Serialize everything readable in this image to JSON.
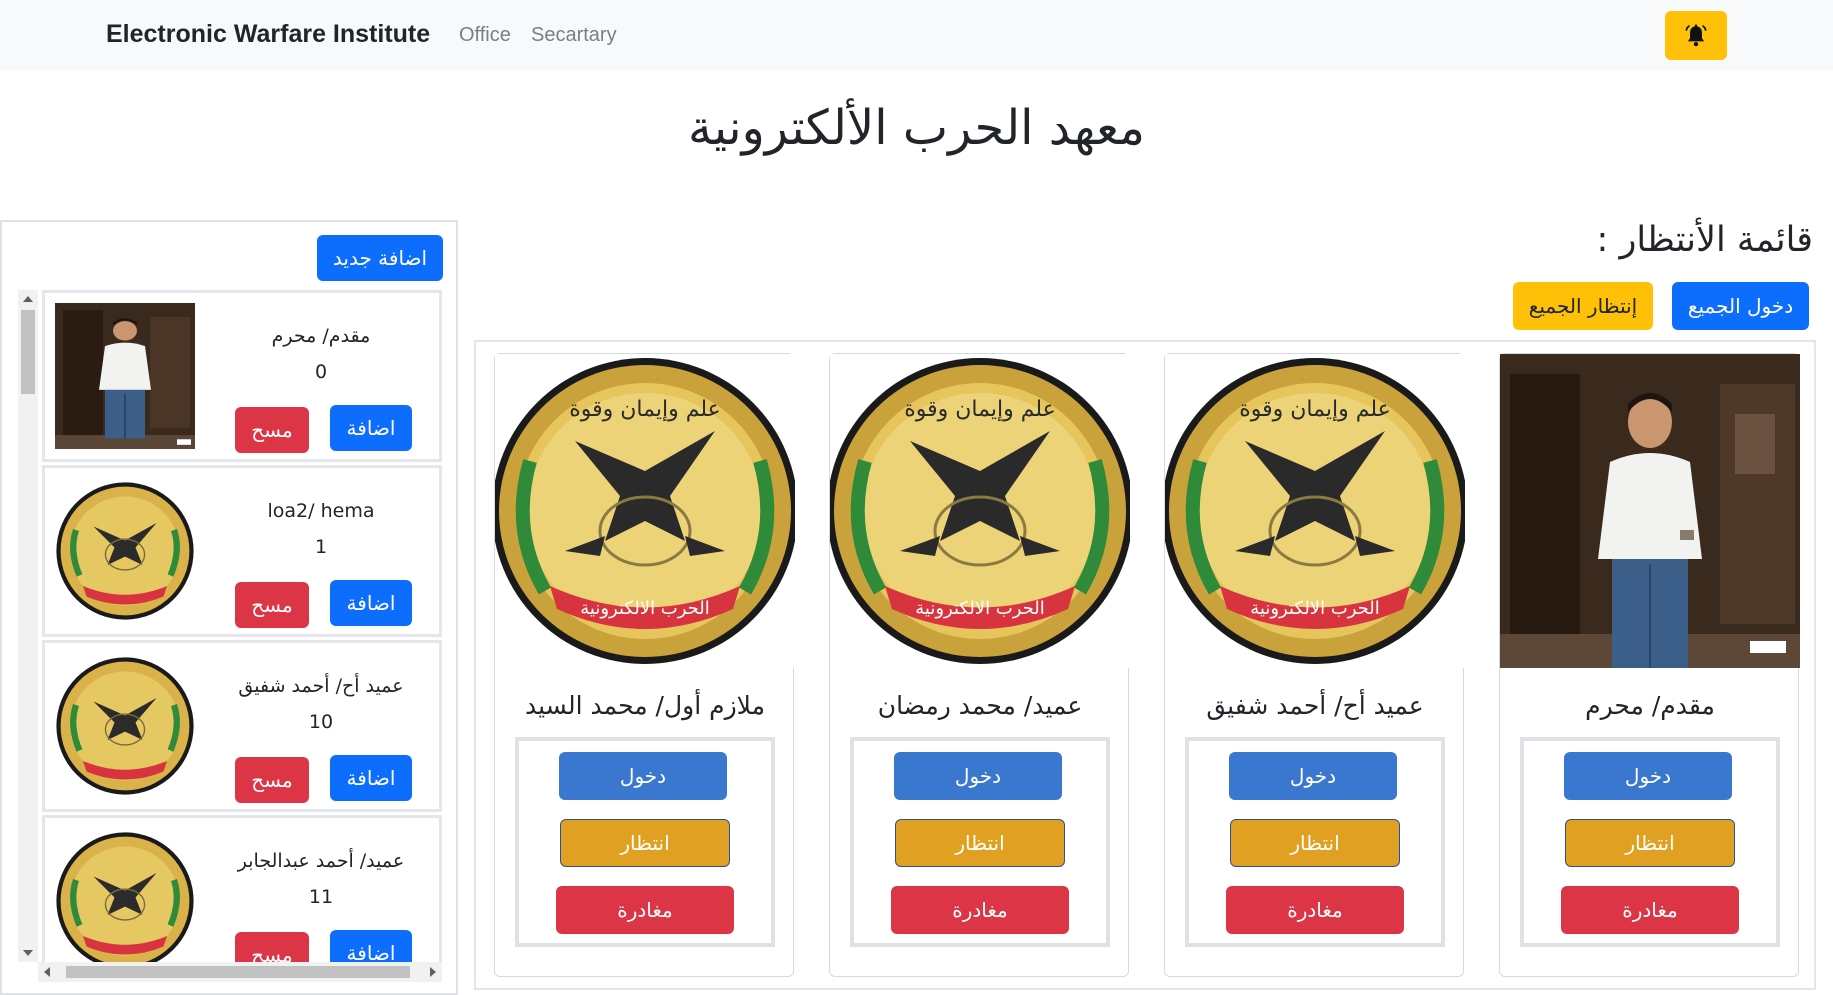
{
  "navbar": {
    "brand": "Electronic Warfare Institute",
    "links": [
      "Office",
      "Secartary"
    ],
    "bell_icon": "bell-icon",
    "bell_color": "#ffc107"
  },
  "page": {
    "title": "معهد الحرب الألكترونية"
  },
  "sidebar": {
    "add_new_label": "اضافة جديد",
    "items": [
      {
        "name": "مقدم/ محرم",
        "count": "0",
        "image": "person-photo",
        "add_label": "اضافة",
        "delete_label": "مسح"
      },
      {
        "name": "loa2/ hema",
        "count": "1",
        "image": "emblem",
        "add_label": "اضافة",
        "delete_label": "مسح"
      },
      {
        "name": "عميد أح/ أحمد شفيق",
        "count": "10",
        "image": "emblem",
        "add_label": "اضافة",
        "delete_label": "مسح"
      },
      {
        "name": "عميد/ أحمد عبدالجابر",
        "count": "11",
        "image": "emblem",
        "add_label": "اضافة",
        "delete_label": "مسح"
      }
    ]
  },
  "waitlist": {
    "title": "قائمة الأنتظار :",
    "enter_all_label": "دخول الجميع",
    "wait_all_label": "إنتظار الجميع",
    "cards": [
      {
        "name": "مقدم/ محرم",
        "image": "person-photo",
        "enter_label": "دخول",
        "wait_label": "انتظار",
        "leave_label": "مغادرة"
      },
      {
        "name": "عميد أح/ أحمد شفيق",
        "image": "emblem",
        "enter_label": "دخول",
        "wait_label": "انتظار",
        "leave_label": "مغادرة"
      },
      {
        "name": "عميد/ محمد رمضان",
        "image": "emblem",
        "enter_label": "دخول",
        "wait_label": "انتظار",
        "leave_label": "مغادرة"
      },
      {
        "name": "ملازم أول/ محمد السيد",
        "image": "emblem",
        "enter_label": "دخول",
        "wait_label": "انتظار",
        "leave_label": "مغادرة"
      }
    ]
  },
  "emblem_text": "الحرب الالكترونية",
  "colors": {
    "primary": "#0d6efd",
    "danger": "#dc3545",
    "warning": "#ffc107",
    "card_enter": "#3a78cf",
    "card_wait": "#e0a021"
  }
}
